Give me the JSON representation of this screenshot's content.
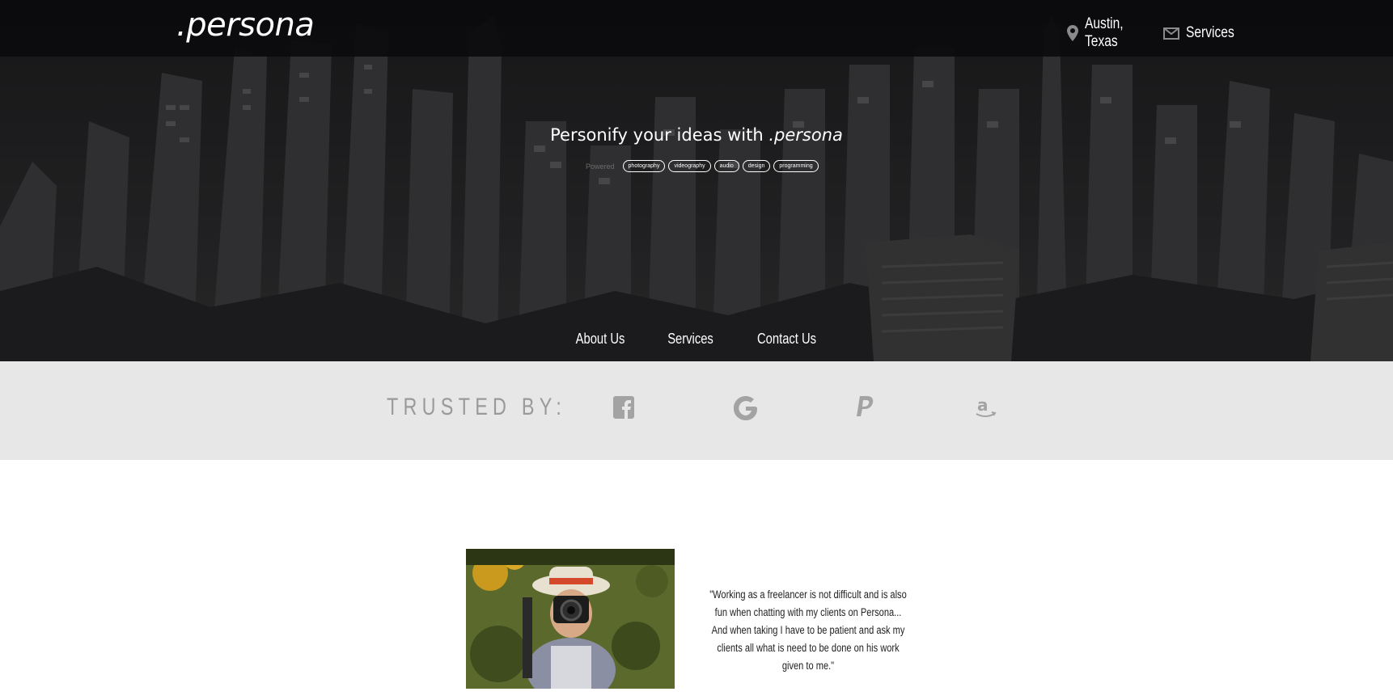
{
  "header": {
    "logo": ".persona",
    "location": "Austin, Texas",
    "services_link": "Services",
    "icons": [
      "map-marker-icon",
      "envelope-icon"
    ]
  },
  "hero": {
    "headline_prefix": "Personify your ideas with",
    "headline_brand": ".persona",
    "tags_prefix": "Powered",
    "tags": [
      "photography",
      "videography",
      "audio",
      "design",
      "programming"
    ],
    "nav": [
      "About Us",
      "Services",
      "Contact Us"
    ]
  },
  "trusted": {
    "label": "TRUSTED BY:",
    "brands": [
      "facebook-icon",
      "google-icon",
      "paypal-icon",
      "amazon-icon"
    ]
  },
  "testimonial": {
    "quote": "\"Working as a freelancer is not difficult and is also fun when chatting with my clients on Persona... And when taking I have to be patient and ask my clients all what is need to be done on his work given to me.\""
  },
  "colors": {
    "hero_bg": "#2a2a2c",
    "topbar_bg": "#0f0f11",
    "trusted_bg": "#e7e7e7",
    "trusted_gray": "#9a9a9a"
  }
}
